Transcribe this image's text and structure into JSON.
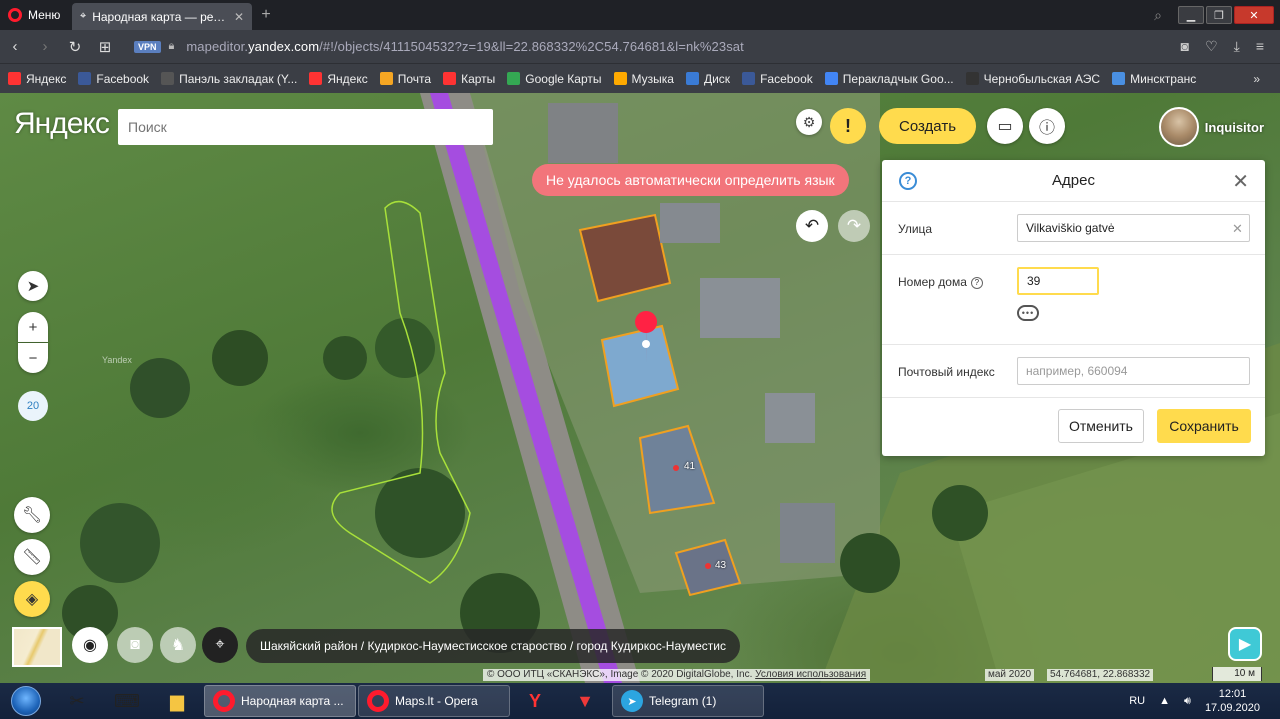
{
  "browser": {
    "menu_label": "Меню",
    "tabs": [
      {
        "title": "Народная карта — редакт",
        "active": true
      }
    ],
    "new_tab": "+",
    "url_prefix": "mapeditor.",
    "url_domain": "yandex.com",
    "url_rest": "/#!/objects/4111504532?z=19&ll=22.868332%2C54.764681&l=nk%23sat",
    "vpn_label": "VPN",
    "bookmarks": [
      {
        "label": "Яндекс",
        "icon": "yandex-icon",
        "color": "#f33"
      },
      {
        "label": "Facebook",
        "icon": "facebook-icon",
        "color": "#3b5998"
      },
      {
        "label": "Панэль закладак (Y...",
        "icon": "folder-icon",
        "color": "#555"
      },
      {
        "label": "Яндекс",
        "icon": "yandex-icon",
        "color": "#f33"
      },
      {
        "label": "Почта",
        "icon": "mail-icon",
        "color": "#f5a623"
      },
      {
        "label": "Карты",
        "icon": "pin-icon",
        "color": "#f33"
      },
      {
        "label": "Google Карты",
        "icon": "google-maps-icon",
        "color": "#34a853"
      },
      {
        "label": "Музыка",
        "icon": "music-icon",
        "color": "#fa0"
      },
      {
        "label": "Диск",
        "icon": "disk-icon",
        "color": "#3a7bd5"
      },
      {
        "label": "Facebook",
        "icon": "facebook-icon",
        "color": "#3b5998"
      },
      {
        "label": "Перакладчык Goo...",
        "icon": "translate-icon",
        "color": "#4285f4"
      },
      {
        "label": "Чернобыльская АЭС",
        "icon": "site-icon",
        "color": "#333"
      },
      {
        "label": "Минсктранс",
        "icon": "image-icon",
        "color": "#4a90e2"
      }
    ],
    "bookmarks_more": "»"
  },
  "map": {
    "logo": "Яндекс",
    "search_placeholder": "Поиск",
    "create_label": "Создать",
    "user_name": "Inquisitor",
    "warning": "Не удалось автоматически определить язык",
    "zoom_level": "20",
    "breadcrumb": "Шакяйский район / Кудиркос-Науместисское староство / город Кудиркос-Науместис",
    "copyright_text": "© ООО ИТЦ «СКАНЭКС», Image © 2020 DigitalGlobe, Inc.",
    "copyright_link": "Условия использования",
    "imagery_date": "май 2020",
    "coordinates": "54.764681, 22.868332",
    "scale": "10 м",
    "house_labels": [
      "41",
      "43"
    ],
    "watermark": "Yandex"
  },
  "panel": {
    "title": "Адрес",
    "street_label": "Улица",
    "street_value": "Vilkaviškio gatvė",
    "house_label": "Номер дома",
    "house_value": "39",
    "postal_label": "Почтовый индекс",
    "postal_placeholder": "например, 660094",
    "cancel_label": "Отменить",
    "save_label": "Сохранить"
  },
  "taskbar": {
    "tasks": [
      {
        "title": "Народная карта ...",
        "active": true
      },
      {
        "title": "Maps.lt - Opera",
        "active": false
      },
      {
        "title": "Telegram (1)",
        "active": false
      }
    ],
    "lang": "RU",
    "time": "12:01",
    "date": "17.09.2020"
  },
  "colors": {
    "accent_yellow": "#ffdb4d",
    "warning_red": "#f2757b",
    "road_purple": "#a54de0",
    "building_outline": "#f0a020"
  }
}
